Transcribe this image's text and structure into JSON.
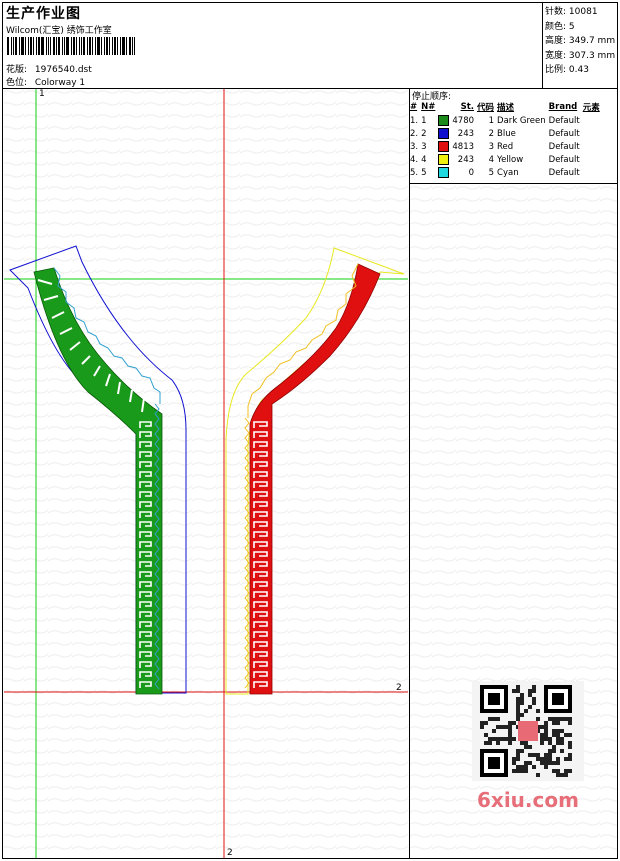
{
  "header": {
    "title": "生产作业图",
    "subtitle": "Wilcom(汇宝) 绣饰工作室",
    "design_label": "花版:",
    "design_value": "1976540.dst",
    "colorway_label": "色位:",
    "colorway_value": "Colorway 1"
  },
  "stats": {
    "stitches_label": "针数:",
    "stitches_value": "10081",
    "colors_label": "颜色:",
    "colors_value": "5",
    "height_label": "高度:",
    "height_value": "349.7 mm",
    "width_label": "宽度:",
    "width_value": "307.3 mm",
    "scale_label": "比例:",
    "scale_value": "0.43"
  },
  "stop_sequence": {
    "title": "停止顺序:",
    "headers": [
      "#",
      "N#",
      "St.",
      "代码",
      "描述",
      "Brand",
      "元素"
    ],
    "rows": [
      {
        "idx": "1.",
        "n": "1",
        "color": "#1a8a1a",
        "st": "4780",
        "code": "1",
        "desc": "Dark Green",
        "brand": "Default"
      },
      {
        "idx": "2.",
        "n": "2",
        "color": "#1010d0",
        "st": "243",
        "code": "2",
        "desc": "Blue",
        "brand": "Default"
      },
      {
        "idx": "3.",
        "n": "3",
        "color": "#e01010",
        "st": "4813",
        "code": "3",
        "desc": "Red",
        "brand": "Default"
      },
      {
        "idx": "4.",
        "n": "4",
        "color": "#f0f010",
        "st": "243",
        "code": "4",
        "desc": "Yellow",
        "brand": "Default"
      },
      {
        "idx": "5.",
        "n": "5",
        "color": "#20d8e0",
        "st": "0",
        "code": "5",
        "desc": "Cyan",
        "brand": "Default"
      }
    ]
  },
  "axis_labels": {
    "top_left": "1",
    "bottom_center": "2",
    "right_mid": "2"
  },
  "watermark": {
    "site": "6xiu.com"
  }
}
